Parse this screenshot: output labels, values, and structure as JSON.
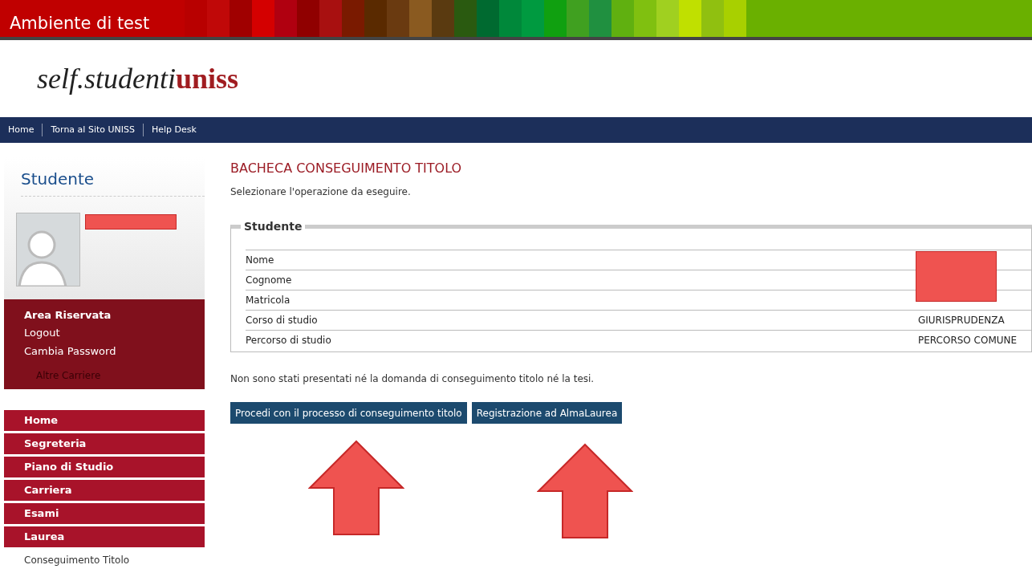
{
  "env_banner": "Ambiente di test",
  "logo": {
    "prefix": "self.studenti",
    "suffix": "uniss"
  },
  "top_nav": [
    "Home",
    "Torna al Sito UNISS",
    "Help Desk"
  ],
  "sidebar": {
    "title": "Studente",
    "area": {
      "title": "Area Riservata",
      "links": [
        "Logout",
        "Cambia Password"
      ],
      "other": "Altre Carriere"
    },
    "menu": [
      {
        "label": "Home",
        "kind": "main"
      },
      {
        "label": "Segreteria",
        "kind": "main"
      },
      {
        "label": "Piano di Studio",
        "kind": "main"
      },
      {
        "label": "Carriera",
        "kind": "main"
      },
      {
        "label": "Esami",
        "kind": "main"
      },
      {
        "label": "Laurea",
        "kind": "main"
      },
      {
        "label": "Conseguimento Titolo",
        "kind": "sub"
      }
    ]
  },
  "main": {
    "title": "BACHECA CONSEGUIMENTO TITOLO",
    "intro": "Selezionare l'operazione da eseguire.",
    "fieldset": {
      "legend": "Studente",
      "rows": [
        {
          "label": "Nome"
        },
        {
          "label": "Cognome"
        },
        {
          "label": "Matricola"
        },
        {
          "label": "Corso di studio",
          "value": "GIURISPRUDENZA"
        },
        {
          "label": "Percorso di studio",
          "value": "PERCORSO COMUNE"
        }
      ]
    },
    "notice": "Non sono stati presentati né la domanda di conseguimento titolo né la tesi.",
    "buttons": [
      "Procedi con il processo di conseguimento titolo",
      "Registrazione ad AlmaLaurea"
    ]
  }
}
